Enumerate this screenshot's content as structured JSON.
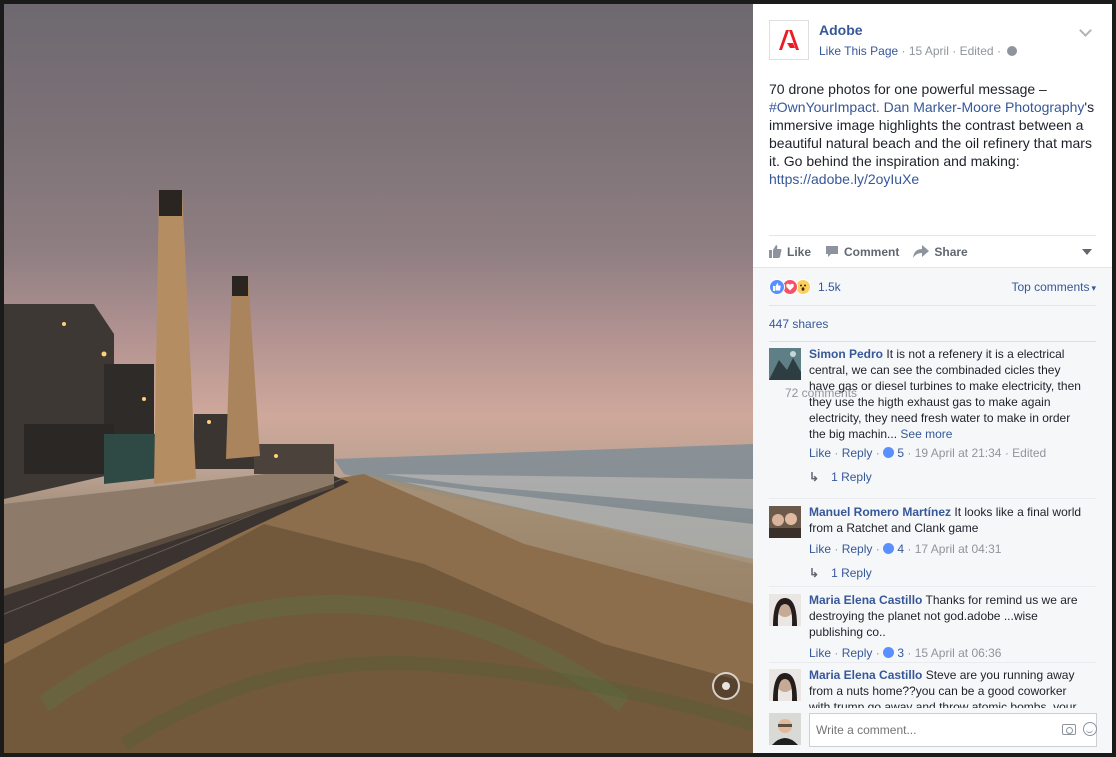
{
  "photo": {
    "alt_subject": "drone-photo",
    "tag_icon": "photo-tag-icon"
  },
  "post": {
    "page_name": "Adobe",
    "like_page": "Like This Page",
    "date": "15 April",
    "edited": "Edited",
    "text_before": "70 drone photos for one powerful message – ",
    "hashtag": "#OwnYourImpact.",
    "photographer_link": "Dan Marker-Moore Photography",
    "text_after": "'s immersive image highlights the contrast between a beautiful natural beach and the oil refinery that mars it. Go behind the inspiration and making: ",
    "url": "https://adobe.ly/2oyIuXe",
    "brand_color": "#ed1c24"
  },
  "actions": {
    "like": "Like",
    "comment": "Comment",
    "share": "Share"
  },
  "feedback": {
    "reaction_count": "1.5k",
    "sort_label": "Top comments",
    "shares": "447 shares",
    "comments_count": "72 comments"
  },
  "comments": [
    {
      "author": "Simon Pedro",
      "text": "It is not a refenery it is a electrical central, we can see the combinaded cicles they have gas or diesel turbines to make electricity, then they use the higth exhaust gas to make again electricity, they need fresh water to make in order the big machin...",
      "see_more": "See more",
      "like": "Like",
      "reply": "Reply",
      "likes": "5",
      "date": "19 April at 21:34",
      "edited": "Edited",
      "replies": "1 Reply"
    },
    {
      "author": "Manuel Romero Martínez",
      "text": "It looks like a final world from a Ratchet and Clank game",
      "like": "Like",
      "reply": "Reply",
      "likes": "4",
      "date": "17 April at 04:31",
      "replies": "1 Reply"
    },
    {
      "author": "Maria Elena Castillo",
      "text": "Thanks for remind us we are destroying the planet not god.adobe ...wise publishing co..",
      "like": "Like",
      "reply": "Reply",
      "likes": "3",
      "date": "15 April at 06:36"
    },
    {
      "author": "Maria Elena Castillo",
      "text": "Steve are you running away from a nuts home??you can be a good coworker with trump go away and throw atomic bombs, your"
    }
  ],
  "composer": {
    "placeholder": "Write a comment..."
  }
}
